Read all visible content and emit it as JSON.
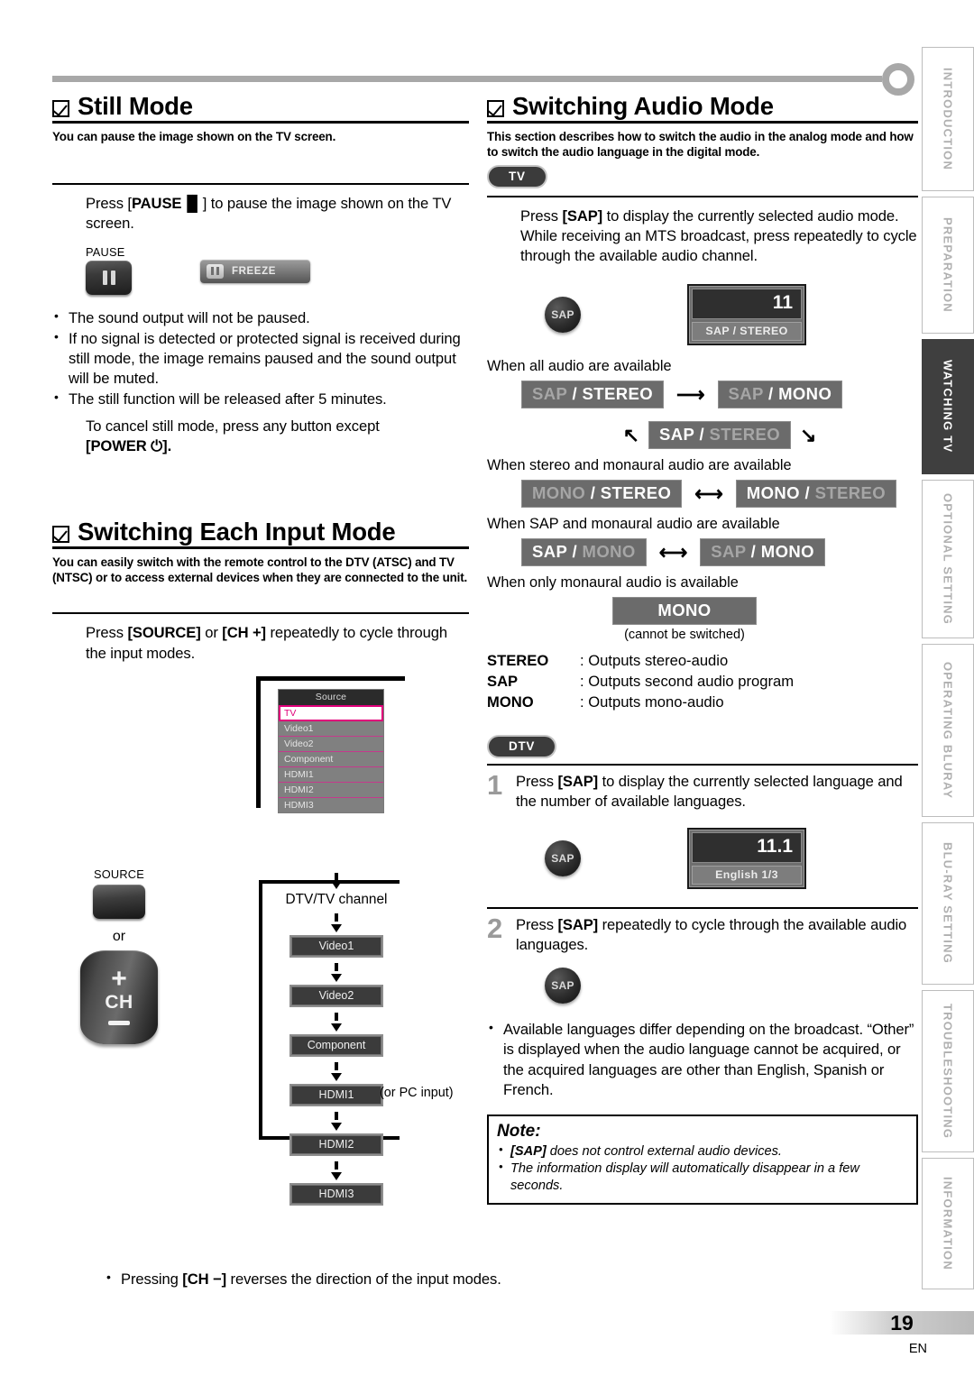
{
  "page": {
    "number": "19",
    "language_code": "EN"
  },
  "sidebar": {
    "tabs": [
      {
        "label": "INTRODUCTION",
        "active": false
      },
      {
        "label": "PREPARATION",
        "active": false
      },
      {
        "label": "WATCHING TV",
        "active": true
      },
      {
        "label": "OPTIONAL SETTING",
        "active": false
      },
      {
        "label": "OPERATING BLURAY",
        "active": false
      },
      {
        "label": "BLU-RAY SETTING",
        "active": false
      },
      {
        "label": "TROUBLESHOOTING",
        "active": false
      },
      {
        "label": "INFORMATION",
        "active": false
      }
    ]
  },
  "still_mode": {
    "title": "Still Mode",
    "lead": "You can pause the image shown on the TV screen.",
    "instruction_pre": "Press [",
    "instruction_key": "PAUSE",
    "instruction_post": "] to pause the image shown on the TV screen.",
    "key_label": "PAUSE",
    "freeze_label": "FREEZE",
    "bullets": [
      "The sound output will not be paused.",
      "If no signal is detected or protected signal is received during still mode, the image remains paused and the sound output will be muted.",
      "The still function will be released after 5 minutes."
    ],
    "cancel_text": "To cancel still mode, press any button except",
    "cancel_key": "[POWER ⏻].",
    "cancel_key_label": "POWER"
  },
  "input_mode": {
    "title": "Switching Each Input Mode",
    "lead": "You can easily switch with the remote control to the DTV (ATSC) and TV (NTSC) or to access external devices when they are connected to the unit.",
    "instruction": "Press [SOURCE] or [CH +] repeatedly to cycle through the input modes.",
    "instruction_parts": {
      "a": "Press ",
      "k1": "[SOURCE]",
      "b": " or ",
      "k2": "[CH +]",
      "c": " repeatedly to cycle through the input modes."
    },
    "osd": {
      "menu_title": "Source",
      "items": [
        "TV",
        "Video1",
        "Video2",
        "Component",
        "HDMI1",
        "HDMI2",
        "HDMI3"
      ],
      "selected": "TV"
    },
    "source_key_label": "SOURCE",
    "or_label": "or",
    "ch_key": {
      "plus": "+",
      "label": "CH",
      "minus": "—"
    },
    "flow": {
      "head": "DTV/TV channel",
      "nodes": [
        "Video1",
        "Video2",
        "Component",
        "HDMI1",
        "HDMI2",
        "HDMI3"
      ],
      "hdmi1_note": "(or PC input)"
    },
    "bullet": "Pressing [CH −] reverses the direction of the input modes.",
    "bullet_parts": {
      "a": "Pressing ",
      "k": "[CH −]",
      "b": " reverses the direction of the input modes."
    }
  },
  "audio_mode": {
    "title": "Switching Audio Mode",
    "lead": "This section describes how to switch the audio in the analog mode and how to switch the audio language in the digital mode.",
    "tv_badge": "TV",
    "dtv_badge": "DTV",
    "tv_instruction": "Press [SAP] to display the currently selected audio mode. While receiving an MTS broadcast, press repeatedly to cycle through the available audio channel.",
    "tv_instruction_parts": {
      "a": "Press ",
      "k": "[SAP]",
      "b": " to display the currently selected audio mode. While receiving an MTS broadcast, press repeatedly to cycle through the available audio channel."
    },
    "sap_button_label": "SAP",
    "tv_osd": {
      "channel": "11",
      "mode": "SAP / STEREO"
    },
    "cycles": [
      {
        "caption": "When all audio are available",
        "type": "triangle",
        "boxes": [
          {
            "left": "SAP",
            "left_dim": true,
            "sep": " / ",
            "right": "STEREO",
            "right_dim": false
          },
          {
            "left": "SAP",
            "left_dim": true,
            "sep": " / ",
            "right": "MONO",
            "right_dim": false
          },
          {
            "left": "SAP",
            "left_dim": false,
            "sep": " / ",
            "right": "STEREO",
            "right_dim": true
          }
        ]
      },
      {
        "caption": "When stereo and monaural audio are available",
        "type": "pair",
        "boxes": [
          {
            "left": "MONO",
            "left_dim": true,
            "sep": " / ",
            "right": "STEREO",
            "right_dim": false
          },
          {
            "left": "MONO",
            "left_dim": false,
            "sep": " / ",
            "right": "STEREO",
            "right_dim": true
          }
        ]
      },
      {
        "caption": "When SAP and monaural audio are available",
        "type": "pair",
        "boxes": [
          {
            "left": "SAP",
            "left_dim": false,
            "sep": " / ",
            "right": "MONO",
            "right_dim": true
          },
          {
            "left": "SAP",
            "left_dim": true,
            "sep": " / ",
            "right": "MONO",
            "right_dim": false
          }
        ]
      },
      {
        "caption": "When only monaural audio is available",
        "type": "single",
        "boxes": [
          {
            "left": "MONO",
            "left_dim": false,
            "sep": "",
            "right": "",
            "right_dim": false
          }
        ],
        "footnote": "(cannot be switched)"
      }
    ],
    "definitions": [
      {
        "term": "STEREO",
        "desc": ": Outputs stereo-audio"
      },
      {
        "term": "SAP",
        "desc": ": Outputs second audio program"
      },
      {
        "term": "MONO",
        "desc": ": Outputs mono-audio"
      }
    ],
    "steps": [
      {
        "n": "1",
        "text": "Press [SAP] to display the currently selected language and the number of available languages.",
        "parts": {
          "a": "Press ",
          "k": "[SAP]",
          "b": " to display the currently selected language and the number of available languages."
        }
      },
      {
        "n": "2",
        "text": "Press [SAP] repeatedly to cycle through the available audio languages.",
        "parts": {
          "a": "Press ",
          "k": "[SAP]",
          "b": " repeatedly to cycle through the available audio languages."
        }
      }
    ],
    "dtv_osd": {
      "channel": "11.1",
      "mode": "English 1/3"
    },
    "dtv_bullet": "Available languages differ depending on the broadcast. “Other” is displayed when the audio language cannot be acquired, or the acquired languages are other than English, Spanish or French.",
    "note": {
      "title": "Note:",
      "items": [
        "[SAP] does not control external audio devices.",
        "The information display will automatically disappear in a few seconds."
      ]
    }
  }
}
